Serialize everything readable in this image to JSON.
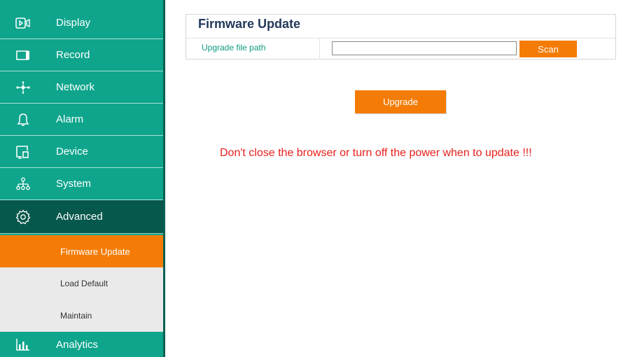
{
  "sidebar": {
    "items": [
      {
        "label": "Display",
        "icon": "display-icon"
      },
      {
        "label": "Record",
        "icon": "record-icon"
      },
      {
        "label": "Network",
        "icon": "network-icon"
      },
      {
        "label": "Alarm",
        "icon": "bell-icon"
      },
      {
        "label": "Device",
        "icon": "device-icon"
      },
      {
        "label": "System",
        "icon": "system-tree-icon"
      },
      {
        "label": "Advanced",
        "icon": "gear-icon",
        "active": true
      },
      {
        "label": "Analytics",
        "icon": "bar-chart-icon"
      }
    ],
    "subitems": [
      {
        "label": "Firmware Update",
        "active": true
      },
      {
        "label": "Load Default"
      },
      {
        "label": "Maintain"
      }
    ]
  },
  "main": {
    "title": "Firmware Update",
    "path_label": "Upgrade file path",
    "path_value": "",
    "scan_label": "Scan",
    "upgrade_label": "Upgrade",
    "warning": "Don't close the browser or turn off the power when to update !!!"
  },
  "colors": {
    "sidebar_teal": "#0ea58c",
    "sidebar_active": "#07584c",
    "accent_orange": "#f47c06",
    "title_navy": "#23395b",
    "warning_red": "#e8201c"
  }
}
